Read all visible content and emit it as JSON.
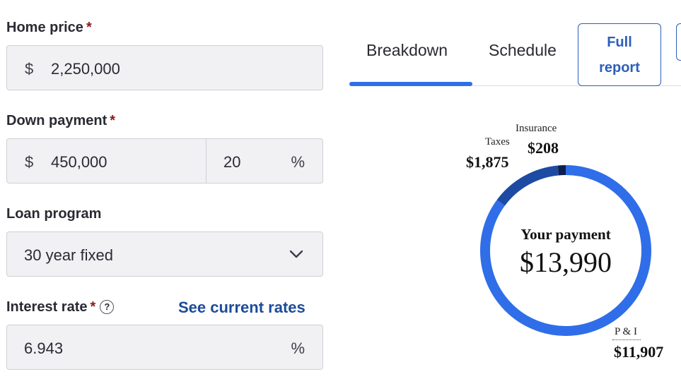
{
  "form": {
    "home_price": {
      "label": "Home price",
      "required_mark": "*",
      "currency": "$",
      "value": "2,250,000"
    },
    "down_payment": {
      "label": "Down payment",
      "required_mark": "*",
      "currency": "$",
      "value": "450,000",
      "percent_value": "20",
      "percent_symbol": "%"
    },
    "loan_program": {
      "label": "Loan program",
      "selected": "30 year fixed"
    },
    "interest_rate": {
      "label": "Interest rate",
      "required_mark": "*",
      "help_symbol": "?",
      "link": "See current rates",
      "value": "6.943",
      "percent_symbol": "%"
    }
  },
  "tabs": [
    {
      "label": "Breakdown",
      "active": true
    },
    {
      "label": "Schedule",
      "active": false
    }
  ],
  "full_report": {
    "line1": "Full",
    "line2": "report"
  },
  "breakdown": {
    "center_title": "Your payment",
    "total": "$13,990",
    "segments": [
      {
        "name": "P & I",
        "amount_label": "$11,907",
        "value": 11907,
        "color": "#2f6ee8"
      },
      {
        "name": "Taxes",
        "amount_label": "$1,875",
        "value": 1875,
        "color": "#1d4ba3"
      },
      {
        "name": "Insurance",
        "amount_label": "$208",
        "value": 208,
        "color": "#0d1f4d"
      }
    ]
  },
  "icons": {
    "chevron": "chevron-down-icon",
    "help": "help-icon"
  }
}
